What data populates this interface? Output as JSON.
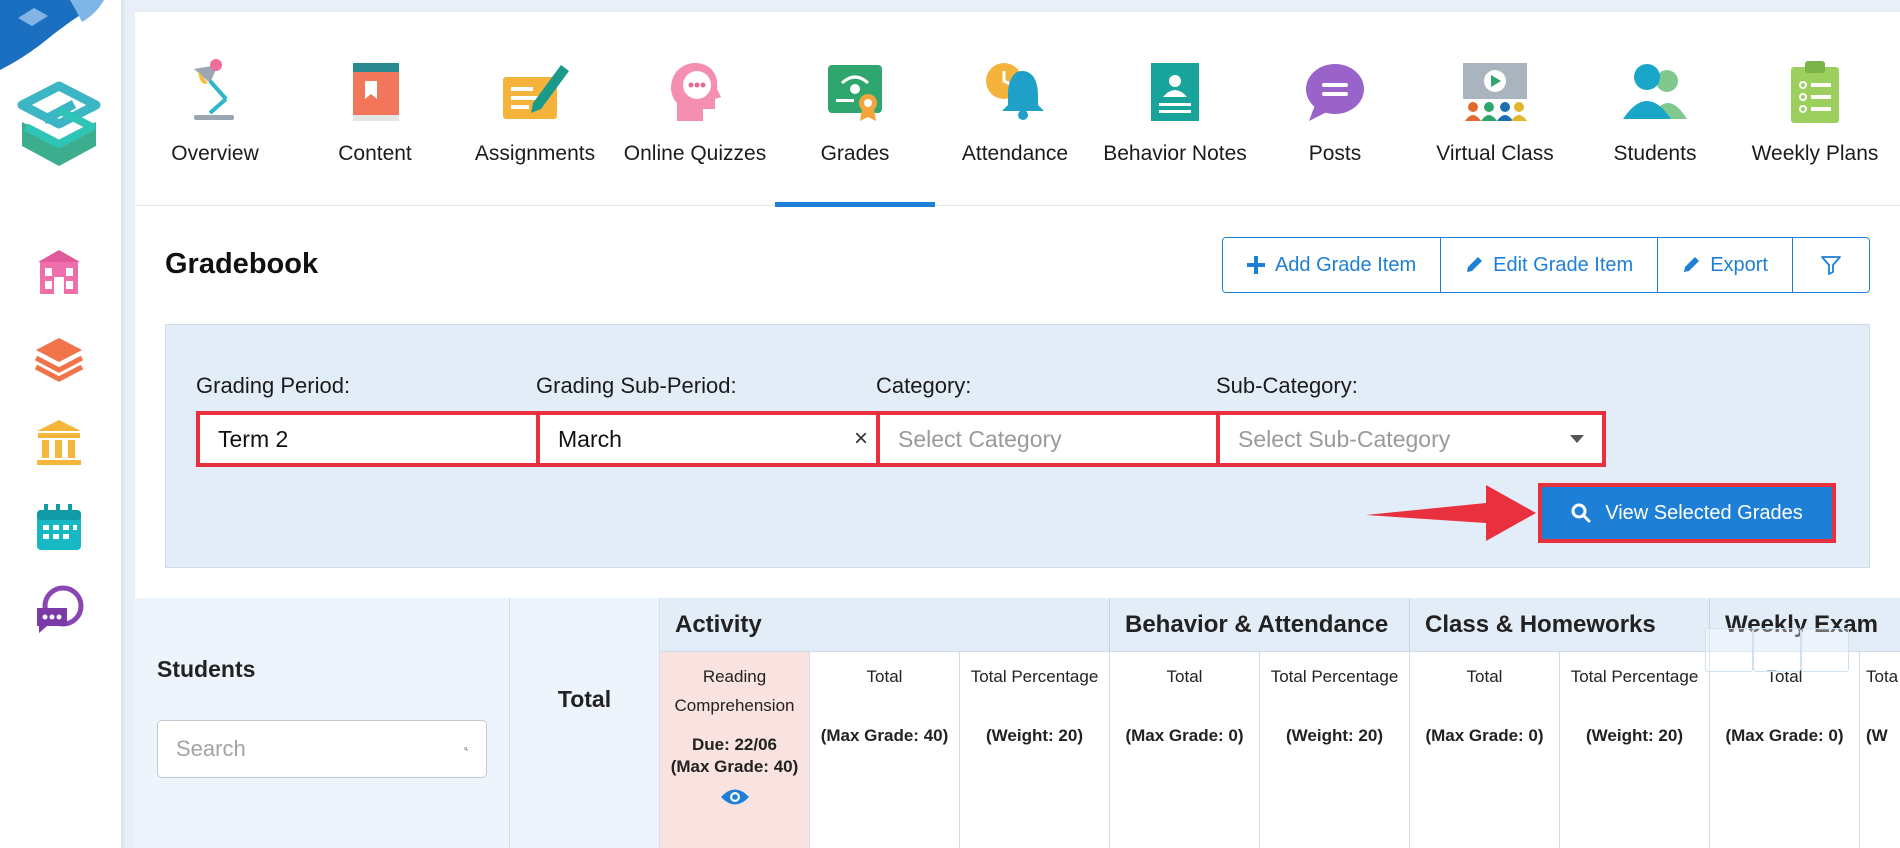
{
  "nav": {
    "items": [
      {
        "label": "Overview",
        "icon": "desk-lamp-icon"
      },
      {
        "label": "Content",
        "icon": "book-icon"
      },
      {
        "label": "Assignments",
        "icon": "pen-paper-icon"
      },
      {
        "label": "Online Quizzes",
        "icon": "head-chat-icon"
      },
      {
        "label": "Grades",
        "icon": "certificate-icon"
      },
      {
        "label": "Attendance",
        "icon": "bell-clock-icon"
      },
      {
        "label": "Behavior Notes",
        "icon": "badge-card-icon"
      },
      {
        "label": "Posts",
        "icon": "speech-bubble-icon"
      },
      {
        "label": "Virtual Class",
        "icon": "video-class-icon"
      },
      {
        "label": "Students",
        "icon": "users-icon"
      },
      {
        "label": "Weekly Plans",
        "icon": "clipboard-list-icon"
      }
    ],
    "active": "Grades"
  },
  "sidebar": {
    "icons": [
      "school-icon",
      "layers-icon",
      "institution-icon",
      "calendar-icon",
      "chat-support-icon"
    ]
  },
  "gradebook": {
    "title": "Gradebook",
    "buttons": {
      "add": "Add Grade Item",
      "edit": "Edit Grade Item",
      "export": "Export"
    }
  },
  "filters": {
    "grading_period": {
      "label": "Grading Period:",
      "value": "Term 2"
    },
    "grading_sub_period": {
      "label": "Grading Sub-Period:",
      "value": "March"
    },
    "category": {
      "label": "Category:",
      "placeholder": "Select Category"
    },
    "sub_category": {
      "label": "Sub-Category:",
      "placeholder": "Select Sub-Category"
    },
    "view_button": "View Selected Grades"
  },
  "table": {
    "students_header": "Students",
    "search_placeholder": "Search",
    "total_header": "Total",
    "groups": [
      {
        "title": "Activity"
      },
      {
        "title": "Behavior & Attendance"
      },
      {
        "title": "Class & Homeworks"
      },
      {
        "title": "Weekly Exam"
      }
    ],
    "columns": {
      "reading": {
        "title": "Reading Comprehension",
        "due": "Due: 22/06",
        "max": "(Max Grade: 40)"
      },
      "act_total": {
        "title": "Total",
        "meta": "(Max Grade: 40)"
      },
      "act_pct": {
        "title": "Total Percentage",
        "meta": "(Weight: 20)"
      },
      "beh_total": {
        "title": "Total",
        "meta": "(Max Grade: 0)"
      },
      "beh_pct": {
        "title": "Total Percentage",
        "meta": "(Weight: 20)"
      },
      "cls_total": {
        "title": "Total",
        "meta": "(Max Grade: 0)"
      },
      "cls_pct": {
        "title": "Total Percentage",
        "meta": "(Weight: 20)"
      },
      "wk_total": {
        "title": "Total",
        "meta": "(Max Grade: 0)"
      },
      "wk_pct": {
        "title": "Tota",
        "meta": "(W"
      }
    }
  },
  "colors": {
    "accent": "#1d7fd6",
    "highlight": "#e8303f",
    "panel": "#e3edf8"
  }
}
